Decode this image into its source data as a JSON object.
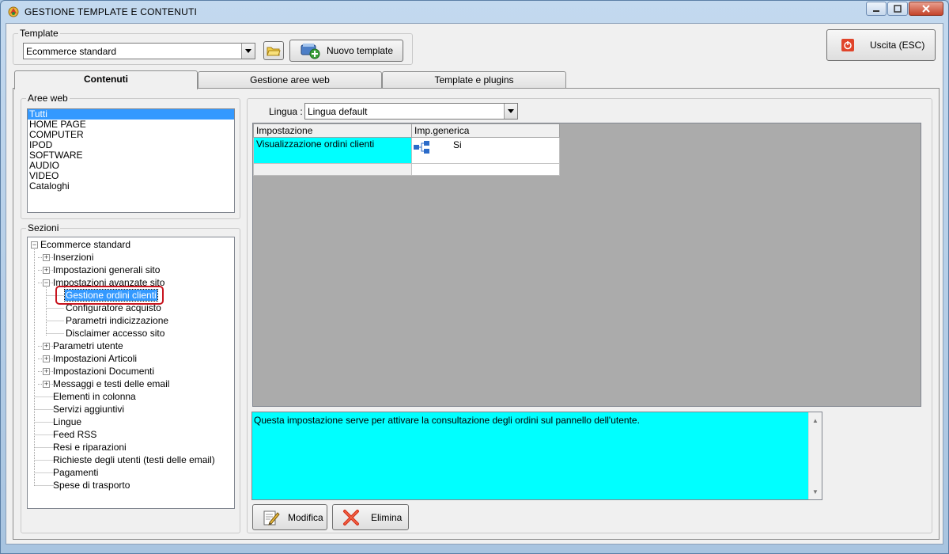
{
  "window": {
    "title": "GESTIONE TEMPLATE E CONTENUTI"
  },
  "template_group": {
    "label": "Template",
    "selected": "Ecommerce standard",
    "new_button": "Nuovo template"
  },
  "exit_button": "Uscita (ESC)",
  "tabs": [
    {
      "label": "Contenuti",
      "active": true
    },
    {
      "label": "Gestione aree web",
      "active": false
    },
    {
      "label": "Template e plugins",
      "active": false
    }
  ],
  "aree_web": {
    "label": "Aree web",
    "items": [
      "Tutti",
      "HOME PAGE",
      "COMPUTER",
      "IPOD",
      "SOFTWARE",
      "AUDIO",
      "VIDEO",
      "Cataloghi"
    ]
  },
  "sezioni": {
    "label": "Sezioni",
    "root": "Ecommerce standard",
    "nodes": [
      "Inserzioni",
      "Impostazioni generali sito",
      "Impostazioni avanzate sito",
      "Gestione ordini clienti",
      "Configuratore acquisto",
      "Parametri indicizzazione",
      "Disclaimer accesso sito",
      "Parametri utente",
      "Impostazioni Articoli",
      "Impostazioni Documenti",
      "Messaggi e testi delle email",
      "Elementi in colonna",
      "Servizi aggiuntivi",
      "Lingue",
      "Feed RSS",
      "Resi e riparazioni",
      "Richieste degli utenti (testi delle email)",
      "Pagamenti",
      "Spese di trasporto"
    ]
  },
  "lingua": {
    "label": "Lingua :",
    "selected": "Lingua default"
  },
  "grid": {
    "columns": [
      "Impostazione",
      "Imp.generica"
    ],
    "rows": [
      {
        "impostazione": "Visualizzazione ordini clienti",
        "valore": "Si"
      }
    ]
  },
  "description": "Questa impostazione serve per attivare la consultazione degli ordini sul pannello dell'utente.",
  "actions": {
    "modifica": "Modifica",
    "elimina": "Elimina"
  },
  "colors": {
    "selection": "#3399ff",
    "cyan": "#00ffff",
    "highlight": "#c8141e",
    "grid_bg": "#ababab"
  }
}
